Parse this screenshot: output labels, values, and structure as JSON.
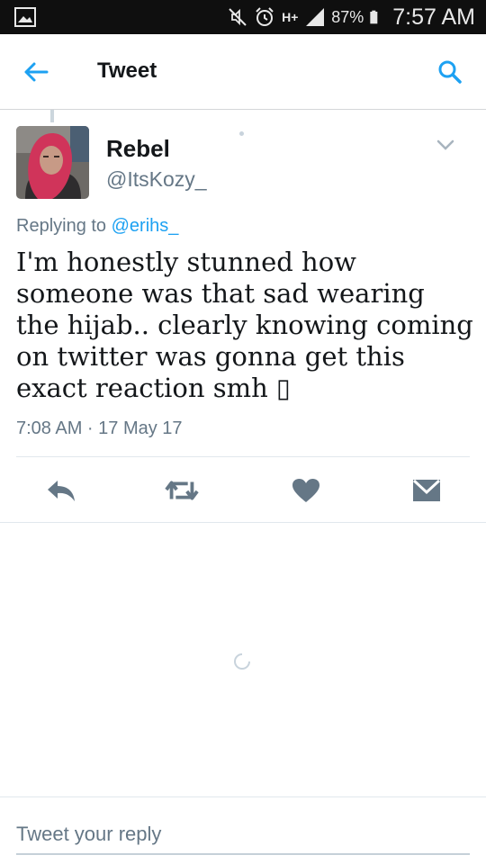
{
  "status_bar": {
    "battery_percent": "87%",
    "time": "7:57 AM",
    "network_label": "H+"
  },
  "header": {
    "title": "Tweet"
  },
  "tweet": {
    "author_name": "Rebel",
    "author_handle": "@ItsKozy_",
    "replying_prefix": "Replying to ",
    "replying_to": "@erihs_",
    "text": "I'm honestly stunned how someone was that sad wearing the hijab.. clearly knowing coming on twitter was gonna get this exact reaction smh ▯",
    "timestamp": "7:08 AM · 17 May 17"
  },
  "reply": {
    "placeholder": "Tweet your reply"
  },
  "colors": {
    "accent": "#1da1f2",
    "action_icon": "#657786",
    "muted_text": "#657786"
  },
  "icons": {
    "status": [
      "gallery-icon",
      "mute-icon",
      "alarm-icon",
      "network-icon",
      "signal-icon",
      "battery-icon"
    ],
    "header": [
      "back-arrow-icon",
      "search-icon"
    ],
    "actions": [
      "reply-icon",
      "retweet-icon",
      "like-icon",
      "direct-message-icon"
    ]
  }
}
